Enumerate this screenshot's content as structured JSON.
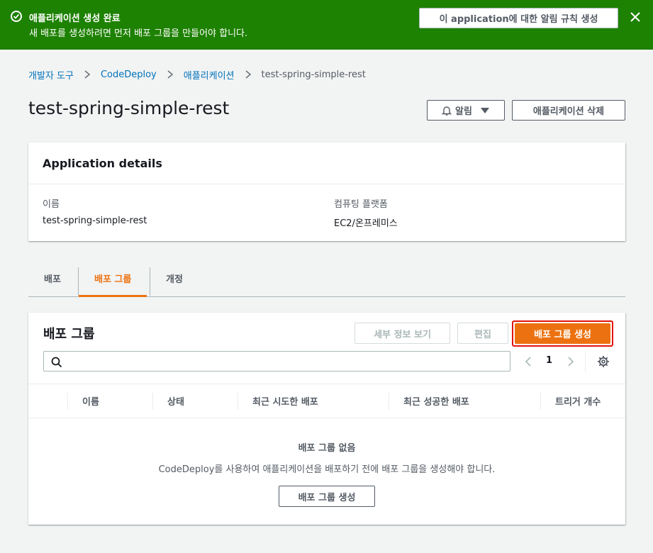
{
  "flash": {
    "title": "애플리케이션 생성 완료",
    "message": "새 배포를 생성하려면 먼저 배포 그룹을 만들어야 합니다.",
    "rule_button": "이 application에 대한 알림 규칙 생성",
    "background": "#1d8102"
  },
  "breadcrumb": {
    "items": [
      "개발자 도구",
      "CodeDeploy",
      "애플리케이션"
    ],
    "current": "test-spring-simple-rest"
  },
  "page": {
    "title": "test-spring-simple-rest",
    "alarm_button": "알림",
    "delete_button": "애플리케이션 삭제"
  },
  "details": {
    "title": "Application details",
    "name_label": "이름",
    "name_value": "test-spring-simple-rest",
    "platform_label": "컴퓨팅 플랫폼",
    "platform_value": "EC2/온프레미스"
  },
  "tabs": {
    "items": [
      "배포",
      "배포 그룹",
      "개정"
    ],
    "active_index": 1,
    "accent": "#ec7211"
  },
  "groups": {
    "title": "배포 그룹",
    "view_details_button": "세부 정보 보기",
    "edit_button": "편집",
    "create_button": "배포 그룹 생성",
    "search_placeholder": "",
    "page": "1",
    "columns": [
      "이름",
      "상태",
      "최근 시도한 배포",
      "최근 성공한 배포",
      "트리거 개수"
    ],
    "empty_title": "배포 그룹 없음",
    "empty_description": "CodeDeploy를 사용하여 애플리케이션을 배포하기 전에 배포 그룹을 생성해야 합니다.",
    "empty_button": "배포 그룹 생성",
    "primary_color": "#ec7211",
    "highlight_color": "#e1140b"
  }
}
